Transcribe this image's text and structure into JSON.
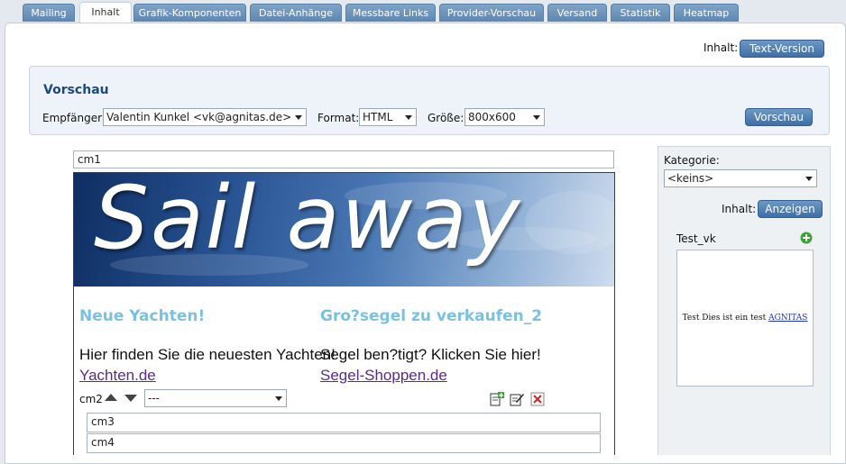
{
  "tabs": [
    {
      "label": "Mailing"
    },
    {
      "label": "Inhalt",
      "active": true
    },
    {
      "label": "Grafik-Komponenten"
    },
    {
      "label": "Datei-Anhänge"
    },
    {
      "label": "Messbare Links"
    },
    {
      "label": "Provider-Vorschau"
    },
    {
      "label": "Versand"
    },
    {
      "label": "Statistik"
    },
    {
      "label": "Heatmap"
    }
  ],
  "top": {
    "inhalt_label": "Inhalt:",
    "text_version_button": "Text-Version"
  },
  "vorschau": {
    "title": "Vorschau",
    "recipient_label": "Empfänger:",
    "recipient_value": "Valentin Kunkel <vk@agnitas.de>",
    "format_label": "Format:",
    "format_value": "HTML",
    "size_label": "Größe:",
    "size_value": "800x600",
    "button": "Vorschau"
  },
  "editor": {
    "component_name": "cm1",
    "banner_text": "Sail away",
    "columns": [
      {
        "title": "Neue Yachten!",
        "text": "Hier finden Sie die neuesten Yachten!",
        "link": "Yachten.de"
      },
      {
        "title": "Gro?segel zu verkaufen_2",
        "text": "Segel ben?tigt? Klicken Sie hier!",
        "link": "Segel-Shoppen.de"
      }
    ],
    "cm2_label": "cm2",
    "cm2_select": "---",
    "sub_components": [
      "cm3",
      "cm4"
    ]
  },
  "sidebar": {
    "category_label": "Kategorie:",
    "category_value": "<keins>",
    "inhalt_label": "Inhalt:",
    "show_button": "Anzeigen",
    "template_name": "Test_vk",
    "thumb_text": "Test Dies ist ein test",
    "thumb_link": "AGNITAS"
  },
  "colors": {
    "tab_blue": "#5f86b0",
    "button_blue": "#3f6fa6",
    "title_blue": "#1e4a7a",
    "column_title": "#7ac1e1",
    "link_purple": "#5a2a91",
    "add_green": "#3aa336",
    "delete_red": "#d32a2a"
  },
  "icons": [
    "arrow-up-icon",
    "arrow-down-icon",
    "add-component-icon",
    "edit-component-icon",
    "delete-component-icon",
    "add-template-icon"
  ]
}
